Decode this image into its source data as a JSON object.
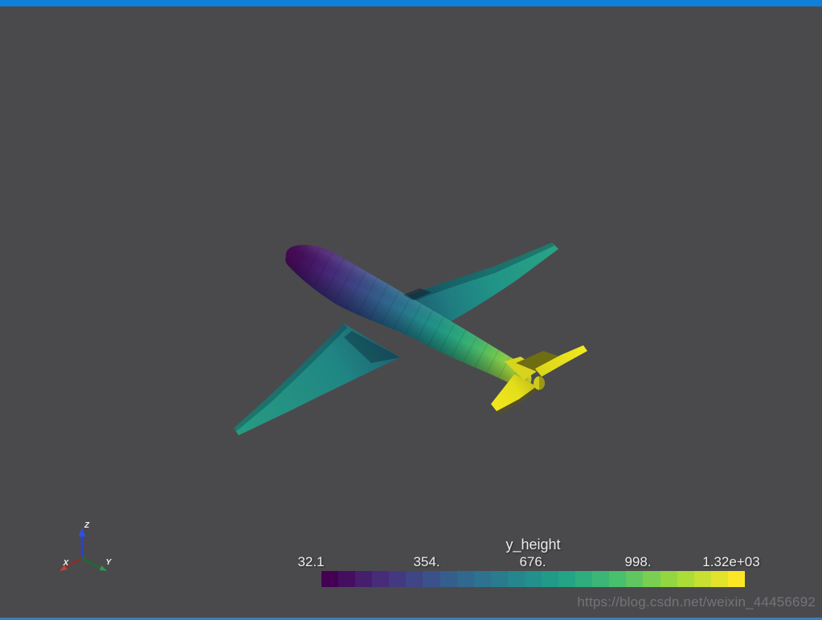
{
  "window": {
    "background_color": "#4a4a4c",
    "top_border_color": "#0e80da",
    "bottom_border_color": "#3e7cba"
  },
  "watermark": {
    "text": "https://blog.csdn.net/weixin_44456692"
  },
  "orientation_axes": {
    "x": {
      "label": "X",
      "color": "#c0392b"
    },
    "y": {
      "label": "Y",
      "color": "#1e8449"
    },
    "z": {
      "label": "Z",
      "color": "#2c4ae0"
    }
  },
  "mesh": {
    "nose_color": "#440a54",
    "mid_color": "#23868b",
    "tail_color": "#fde725"
  },
  "chart_data": {
    "type": "colorbar",
    "title": "y_height",
    "colormap": "viridis",
    "orientation": "horizontal",
    "n_colors": 25,
    "range": [
      32.1,
      1320
    ],
    "tick_labels": [
      "32.1",
      "354.",
      "676.",
      "998.",
      "1.32e+03"
    ],
    "tick_values": [
      32.1,
      354,
      676,
      998,
      1320
    ],
    "colors": [
      "#440154",
      "#450f60",
      "#451e6c",
      "#462c79",
      "#433981",
      "#3f4585",
      "#3a5289",
      "#355e8d",
      "#31688d",
      "#2d728e",
      "#287c8e",
      "#25868d",
      "#23908b",
      "#219a89",
      "#23a485",
      "#2fad7d",
      "#3cb676",
      "#48c06e",
      "#60c760",
      "#79cf51",
      "#92d642",
      "#acdc37",
      "#c7e031",
      "#e2e32b",
      "#fde725"
    ]
  }
}
